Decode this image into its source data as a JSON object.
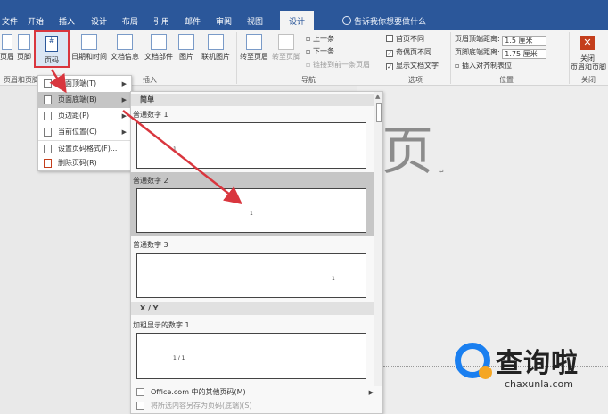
{
  "tabs": {
    "file": "文件",
    "home": "开始",
    "insert": "插入",
    "design": "设计",
    "layout": "布局",
    "references": "引用",
    "mailings": "邮件",
    "review": "审阅",
    "view": "视图",
    "active_design": "设计",
    "tell_me": "告诉我你想要做什么"
  },
  "ribbon": {
    "header": "页眉",
    "footer": "页脚",
    "page_number": "页码",
    "datetime": "日期和时间",
    "doc_info": "文档信息",
    "doc_parts": "文档部件",
    "picture": "图片",
    "online_picture": "联机图片",
    "goto_header": "转至页眉",
    "goto_footer": "转至页脚",
    "previous": "上一条",
    "next": "下一条",
    "link_previous": "链接到前一条页眉",
    "diff_first": "首页不同",
    "diff_odd_even": "奇偶页不同",
    "show_doc_text": "显示文档文字",
    "header_top_label": "页眉顶端距离:",
    "header_top_value": "1.5 厘米",
    "footer_bottom_label": "页脚底端距离:",
    "footer_bottom_value": "1.75 厘米",
    "insert_align_tab": "插入对齐制表位",
    "close_label1": "关闭",
    "close_label2": "页眉和页脚",
    "group_hf": "页眉和页脚",
    "group_insert": "插入",
    "group_nav": "导航",
    "group_options": "选项",
    "group_position": "位置",
    "group_close": "关闭"
  },
  "menu": {
    "top_of_page": "页面顶端(T)",
    "bottom_of_page": "页面底端(B)",
    "page_margins": "页边距(P)",
    "current_position": "当前位置(C)",
    "format_page_numbers": "设置页码格式(F)...",
    "remove_page_numbers": "删除页码(R)"
  },
  "gallery": {
    "section_simple": "简单",
    "item1": "普通数字 1",
    "item2": "普通数字 2",
    "item3": "普通数字 3",
    "section_xy": "X / Y",
    "item4": "加粗显示的数字 1",
    "num_sample": "1",
    "xy_sample": "1 / 1",
    "more_office": "Office.com 中的其他页码(M)",
    "save_selection": "将所选内容另存为页码(底端)(S)"
  },
  "document": {
    "big_char": "页"
  },
  "watermark": {
    "cn": "查询啦",
    "en": "chaxunla.com"
  },
  "colors": {
    "accent": "#2b579a",
    "highlight_box": "#d9363e",
    "arrow": "#d9363e"
  }
}
